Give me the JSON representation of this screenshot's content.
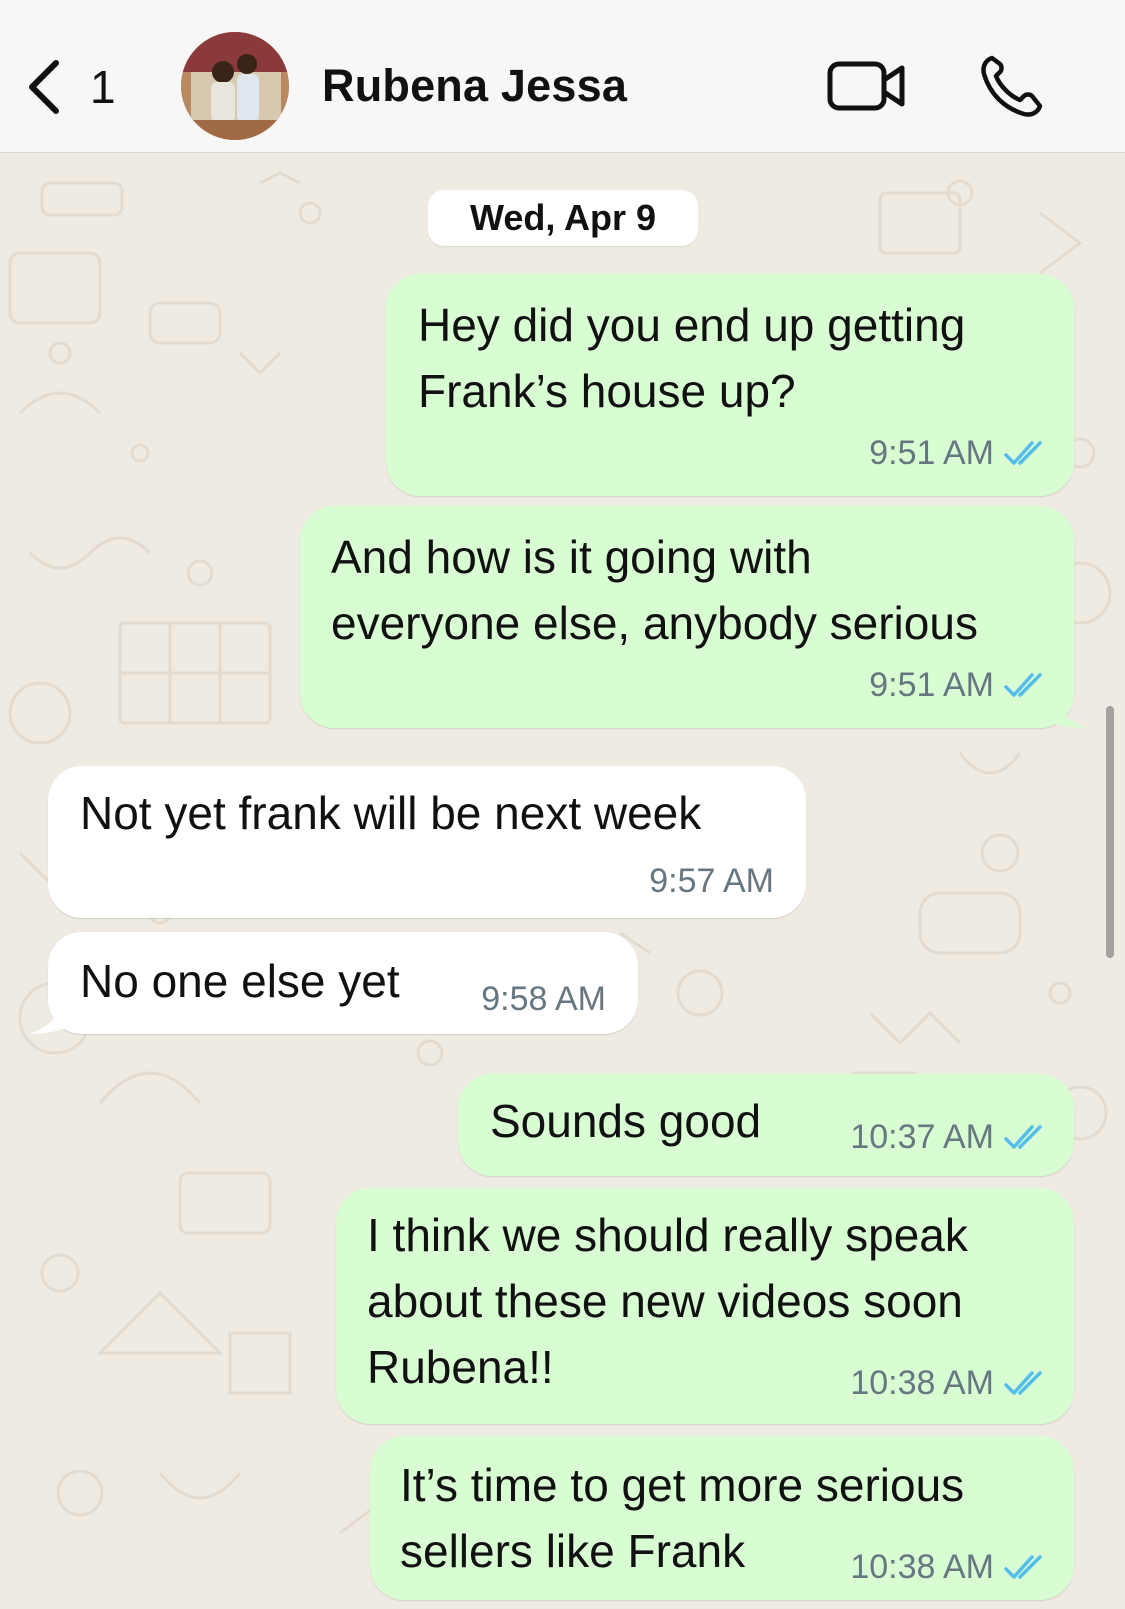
{
  "header": {
    "back_count": "1",
    "contact_name": "Rubena Jessa"
  },
  "date_chip": "Wed, Apr 9",
  "messages": [
    {
      "direction": "out",
      "lines": [
        "Hey did you end up getting",
        "Frank’s house up?"
      ],
      "time": "9:51 AM",
      "status": "read"
    },
    {
      "direction": "out",
      "lines": [
        "And how is it going with",
        "everyone else, anybody serious"
      ],
      "time": "9:51 AM",
      "status": "read"
    },
    {
      "direction": "in",
      "lines": [
        "Not yet frank will be next week"
      ],
      "time": "9:57 AM"
    },
    {
      "direction": "in",
      "lines": [
        "No one else yet"
      ],
      "time": "9:58 AM"
    },
    {
      "direction": "out",
      "lines": [
        "Sounds good"
      ],
      "time": "10:37 AM",
      "status": "read"
    },
    {
      "direction": "out",
      "lines": [
        "I think we should really speak",
        "about these new videos soon",
        "Rubena!!"
      ],
      "time": "10:38 AM",
      "status": "read"
    },
    {
      "direction": "out",
      "lines": [
        "It’s time to get more serious",
        "sellers like Frank"
      ],
      "time": "10:38 AM",
      "status": "read"
    }
  ],
  "colors": {
    "outgoing_bubble": "#d9fdd3",
    "incoming_bubble": "#ffffff",
    "chat_background": "#efeae2",
    "read_ticks": "#53bdeb",
    "meta_text": "#667781"
  }
}
